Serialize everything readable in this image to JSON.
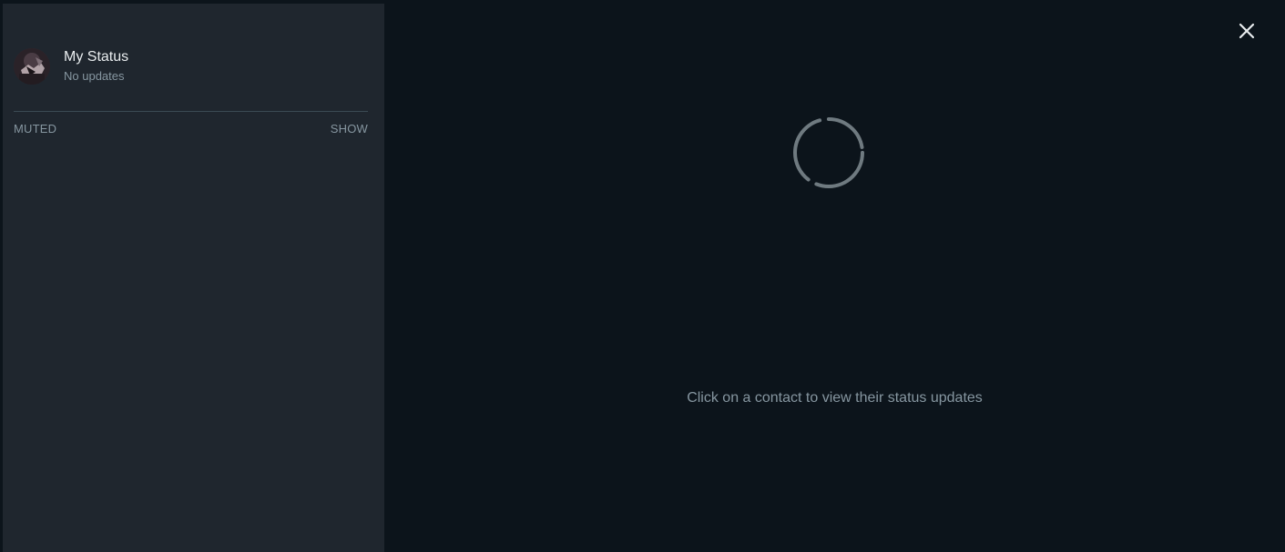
{
  "sidebar": {
    "my_status": {
      "title": "My Status",
      "subtitle": "No updates",
      "avatar_icon": "profile-photo"
    },
    "muted_section": {
      "label": "MUTED",
      "toggle_label": "SHOW"
    }
  },
  "main": {
    "hint_text": "Click on a contact to view their status updates",
    "spinner_icon": "loading-spinner-icon"
  },
  "header": {
    "close_icon": "close-icon"
  },
  "colors": {
    "background": "#0c141b",
    "sidebar": "#1f262e",
    "primary_text": "#e9edef",
    "secondary_text": "#8696a0",
    "divider": "#3b4a54",
    "spinner": "#6f7a80"
  }
}
